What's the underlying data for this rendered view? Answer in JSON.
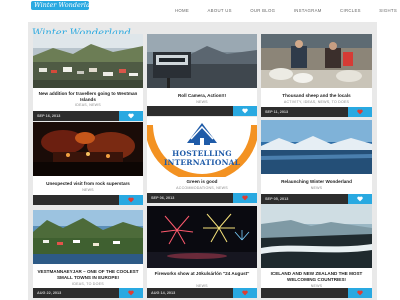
{
  "site": {
    "logo_text": "Winter Wonderland",
    "blog_title": "Winter Wonderland"
  },
  "nav": {
    "items": [
      "HOME",
      "ABOUT US",
      "OUR BLOG",
      "INSTAGRAM",
      "CIRCLES",
      "SIGHTS"
    ]
  },
  "colors": {
    "accent_blue": "#29a9e1",
    "like_red": "#e03c31",
    "footer_dark": "#2d2d2d"
  },
  "posts": [
    {
      "title": "New addition for travellers going to Westman Islands",
      "category": "IDEAS, NEWS",
      "date": "SEP 16, 2013",
      "like_state": "liked",
      "like_icon": "heart-icon"
    },
    {
      "title": "Roll Camera, Action!!!",
      "category": "NEWS",
      "date": "",
      "like_state": "liked",
      "like_icon": "heart-icon"
    },
    {
      "title": "Thousand sheep and the locals",
      "category": "ACTIVITY, IDEAS, NEWS, TO DOES",
      "date": "SEP 11, 2013",
      "like_state": "default",
      "like_icon": "heart-icon"
    },
    {
      "title": "Unexpected visit from rock superstars",
      "category": "NEWS",
      "date": "",
      "like_state": "default",
      "like_icon": "heart-icon"
    },
    {
      "title": "Green is good",
      "category": "ACCOMMODATIONS, NEWS",
      "date": "SEP 06, 2013",
      "like_state": "default",
      "like_icon": "heart-icon"
    },
    {
      "title": "Relaunching Winter Wonderland",
      "category": "NEWS",
      "date": "SEP 05, 2013",
      "like_state": "liked",
      "like_icon": "heart-icon"
    },
    {
      "title": "VESTMANNAEYJAR – ONE OF THE COOLEST SMALL TOWNS IN EUROPE!",
      "category": "IDEAS, TO DOES",
      "date": "AUG 22, 2013",
      "like_state": "default",
      "like_icon": "heart-icon"
    },
    {
      "title": "Fireworks show at Jökulsárlón ''24 August''",
      "category": "NEWS",
      "date": "AUG 14, 2013",
      "like_state": "default",
      "like_icon": "heart-icon"
    },
    {
      "title": "ICELAND AND NEW ZEALAND THE MOST WELCOMING COUNTRIES!",
      "category": "NEWS",
      "date": "",
      "like_state": "default",
      "like_icon": "heart-icon"
    }
  ],
  "hostelling_logo": {
    "line1": "HOSTELLING",
    "line2": "INTERNATIONAL"
  }
}
